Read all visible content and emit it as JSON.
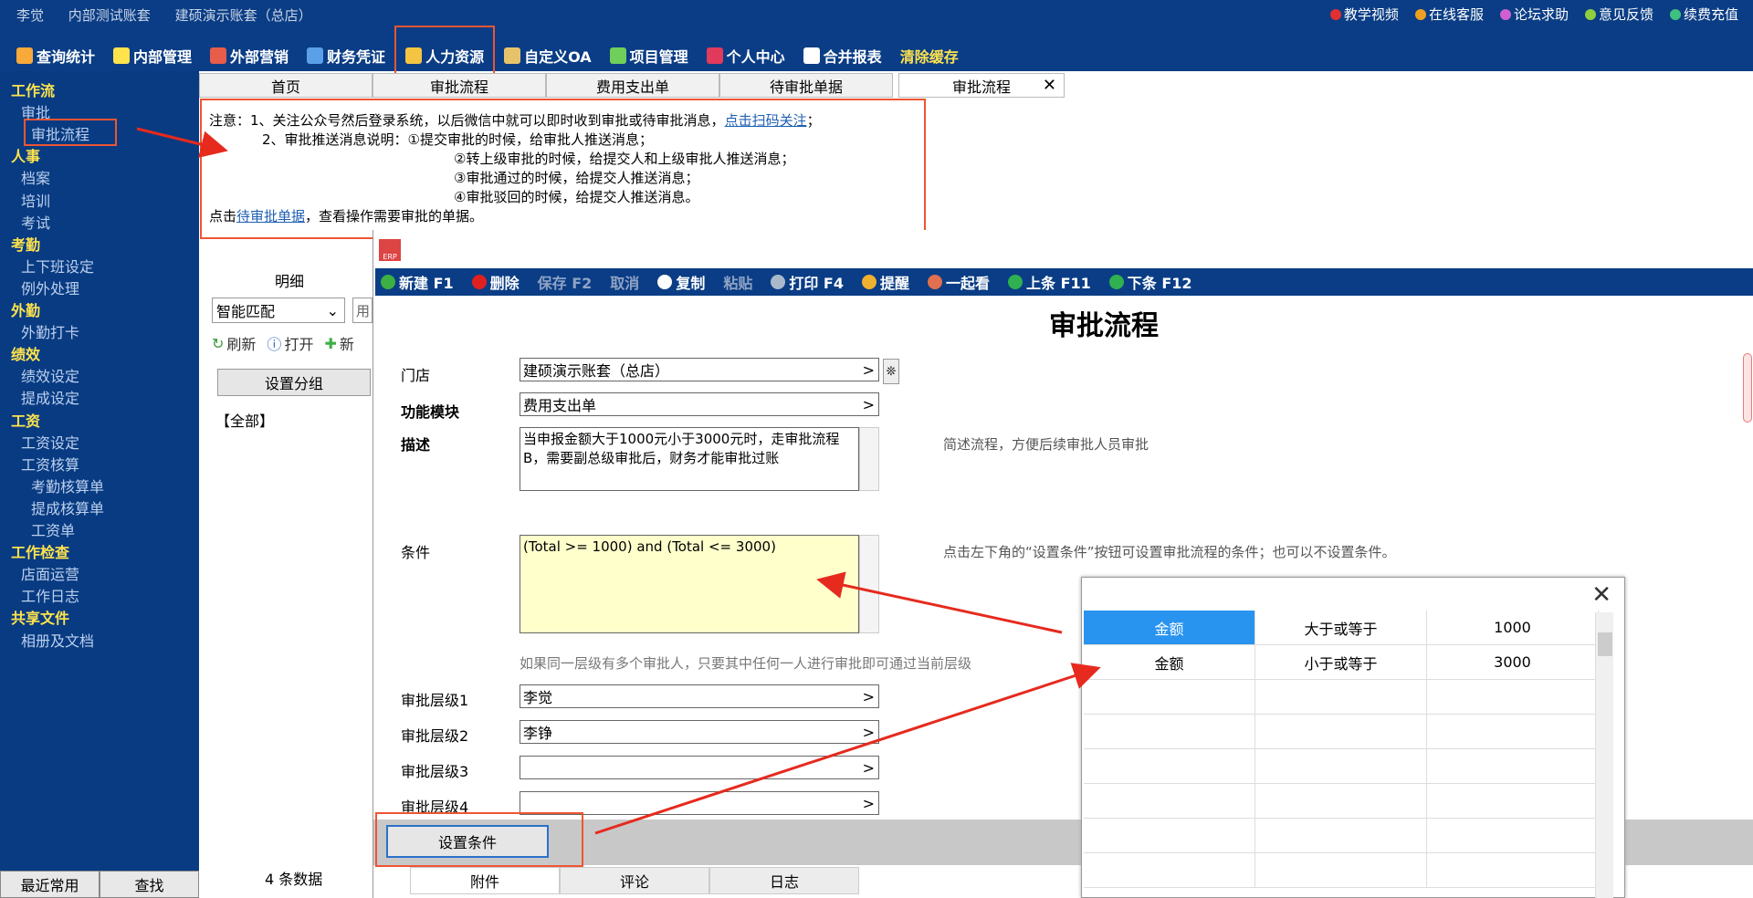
{
  "top": {
    "user": "李觉",
    "account": "内部测试账套",
    "store": "建硕演示账套（总店）",
    "links": [
      {
        "label": "教学视频",
        "color": "#e03030"
      },
      {
        "label": "在线客服",
        "color": "#f0a020"
      },
      {
        "label": "论坛求助",
        "color": "#d060d0"
      },
      {
        "label": "意见反馈",
        "color": "#90d040"
      },
      {
        "label": "续费充值",
        "color": "#40c080"
      }
    ]
  },
  "menu": [
    {
      "label": "查询统计",
      "color": "#f7a93a"
    },
    {
      "label": "内部管理",
      "color": "#ffe34d"
    },
    {
      "label": "外部营销",
      "color": "#e85c4a"
    },
    {
      "label": "财务凭证",
      "color": "#5aa0e8"
    },
    {
      "label": "人力资源",
      "color": "#f4c542"
    },
    {
      "label": "自定义OA",
      "color": "#e6c36a"
    },
    {
      "label": "项目管理",
      "color": "#6fcf5a"
    },
    {
      "label": "个人中心",
      "color": "#e23a5a"
    },
    {
      "label": "合并报表",
      "color": "#ffffff"
    },
    {
      "label": "清除缓存",
      "color": ""
    }
  ],
  "sidebar": {
    "items": [
      {
        "label": "工作流",
        "type": "h",
        "indent": 0
      },
      {
        "label": "审批",
        "type": "i",
        "indent": 1
      },
      {
        "label": "审批流程",
        "type": "i",
        "indent": 2
      },
      {
        "label": "人事",
        "type": "h",
        "indent": 0
      },
      {
        "label": "档案",
        "type": "i",
        "indent": 1
      },
      {
        "label": "培训",
        "type": "i",
        "indent": 1
      },
      {
        "label": "考试",
        "type": "i",
        "indent": 1
      },
      {
        "label": "考勤",
        "type": "h",
        "indent": 0
      },
      {
        "label": "上下班设定",
        "type": "i",
        "indent": 1
      },
      {
        "label": "例外处理",
        "type": "i",
        "indent": 1
      },
      {
        "label": "外勤",
        "type": "h",
        "indent": 0
      },
      {
        "label": "外勤打卡",
        "type": "i",
        "indent": 1
      },
      {
        "label": "绩效",
        "type": "h",
        "indent": 0
      },
      {
        "label": "绩效设定",
        "type": "i",
        "indent": 1
      },
      {
        "label": "提成设定",
        "type": "i",
        "indent": 1
      },
      {
        "label": "工资",
        "type": "h",
        "indent": 0
      },
      {
        "label": "工资设定",
        "type": "i",
        "indent": 1
      },
      {
        "label": "工资核算",
        "type": "i",
        "indent": 1
      },
      {
        "label": "考勤核算单",
        "type": "i",
        "indent": 2
      },
      {
        "label": "提成核算单",
        "type": "i",
        "indent": 2
      },
      {
        "label": "工资单",
        "type": "i",
        "indent": 2
      },
      {
        "label": "工作检查",
        "type": "h",
        "indent": 0
      },
      {
        "label": "店面运营",
        "type": "i",
        "indent": 1
      },
      {
        "label": "工作日志",
        "type": "i",
        "indent": 1
      },
      {
        "label": "共享文件",
        "type": "h",
        "indent": 0
      },
      {
        "label": "相册及文档",
        "type": "i",
        "indent": 1
      }
    ],
    "bottom": [
      "最近常用",
      "查找"
    ]
  },
  "tabs": [
    "首页",
    "审批流程",
    "费用支出单",
    "待审批单据",
    "审批流程"
  ],
  "notice": {
    "l1a": "注意：1、关注公众号然后登录系统，以后微信中就可以即时收到审批或待审批消息，",
    "l1link": "点击扫码关注",
    "l1b": "；",
    "l2": "2、审批推送消息说明：①提交审批的时候，给审批人推送消息；",
    "l3": "②转上级审批的时候，给提交人和上级审批人推送消息；",
    "l4": "③审批通过的时候，给提交人推送消息；",
    "l5": "④审批驳回的时候，给提交人推送消息。",
    "l6a": "点击",
    "l6link": "待审批单据",
    "l6b": "，查看操作需要审批的单据。"
  },
  "leftpanel": {
    "tab": "明细",
    "select": "智能匹配",
    "input": "用",
    "tools": [
      "刷新",
      "打开",
      "新"
    ],
    "group_button": "设置分组",
    "all": "【全部】",
    "count": "4 条数据"
  },
  "toolbar": [
    {
      "label": "新建 F1",
      "enabled": true,
      "color": "#3cb043"
    },
    {
      "label": "删除",
      "enabled": true,
      "color": "#e02020"
    },
    {
      "label": "保存 F2",
      "enabled": false,
      "color": ""
    },
    {
      "label": "取消",
      "enabled": false,
      "color": ""
    },
    {
      "label": "复制",
      "enabled": true,
      "color": "#ffffff"
    },
    {
      "label": "粘贴",
      "enabled": false,
      "color": ""
    },
    {
      "label": "打印 F4",
      "enabled": true,
      "color": "#aab8cc"
    },
    {
      "label": "提醒",
      "enabled": true,
      "color": "#f0b030"
    },
    {
      "label": "一起看",
      "enabled": true,
      "color": "#e07050"
    },
    {
      "label": "上条 F11",
      "enabled": true,
      "color": "#30b050"
    },
    {
      "label": "下条 F12",
      "enabled": true,
      "color": "#30b050"
    }
  ],
  "form": {
    "title": "审批流程",
    "store_label": "门店",
    "store_value": "建硕演示账套（总店）",
    "module_label": "功能模块",
    "module_value": "费用支出单",
    "desc_label": "描述",
    "desc_value": "当申报金额大于1000元小于3000元时，走审批流程B，需要副总级审批后，财务才能审批过账",
    "desc_hint": "简述流程，方便后续审批人员审批",
    "cond_label": "条件",
    "cond_value": "(Total >= 1000) and (Total <= 3000)",
    "cond_hint": "点击左下角的“设置条件”按钮可设置审批流程的条件；也可以不设置条件。",
    "level_hint": "如果同一层级有多个审批人，只要其中任何一人进行审批即可通过当前层级",
    "levels": [
      {
        "label": "审批层级1",
        "value": "李觉"
      },
      {
        "label": "审批层级2",
        "value": "李铮"
      },
      {
        "label": "审批层级3",
        "value": ""
      },
      {
        "label": "审批层级4",
        "value": ""
      }
    ],
    "cond_button": "设置条件",
    "bottom_tabs": [
      "附件",
      "评论",
      "日志"
    ]
  },
  "popup": {
    "rows": [
      [
        "金额",
        "大于或等于",
        "1000"
      ],
      [
        "金额",
        "小于或等于",
        "3000"
      ]
    ],
    "empty_rows": 6
  }
}
